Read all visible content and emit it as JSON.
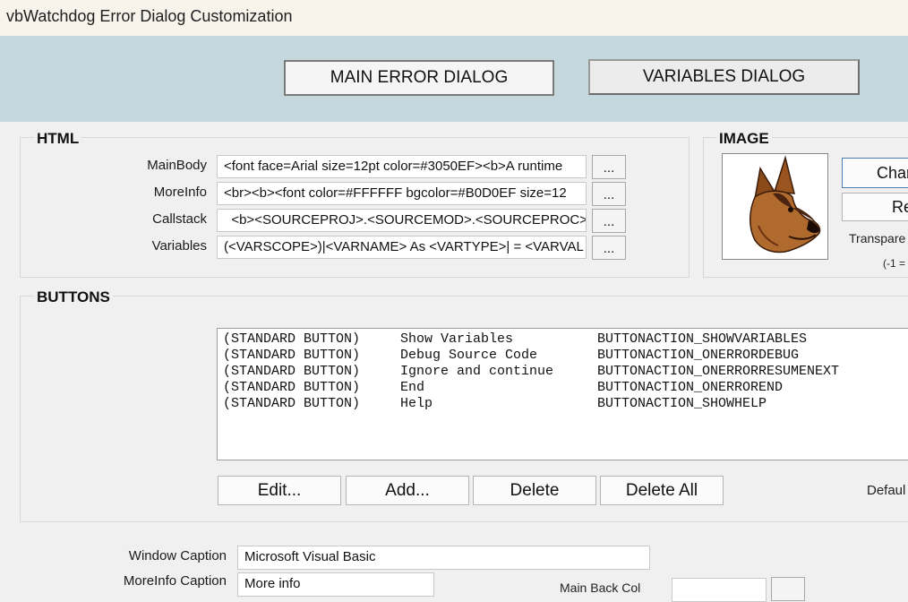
{
  "window": {
    "title": "vbWatchdog Error Dialog Customization"
  },
  "tabs": [
    {
      "label": "MAIN ERROR DIALOG"
    },
    {
      "label": "VARIABLES DIALOG"
    }
  ],
  "html_group": {
    "title": "HTML",
    "rows": [
      {
        "label": "MainBody",
        "value": "<font face=Arial size=12pt color=#3050EF><b>A runtime",
        "browse": "..."
      },
      {
        "label": "MoreInfo",
        "value": "<br><b><font color=#FFFFFF bgcolor=#B0D0EF size=12",
        "browse": "..."
      },
      {
        "label": "Callstack",
        "value": "  <b><SOURCEPROJ>.<SOURCEMOD>.<SOURCEPROC>",
        "browse": "..."
      },
      {
        "label": "Variables",
        "value": "(<VARSCOPE>)|<VARNAME> As <VARTYPE>| = <VARVAL",
        "browse": "..."
      }
    ]
  },
  "image_group": {
    "title": "IMAGE",
    "change_label": "Chan",
    "reset_label": "Re",
    "transparent_label": "Transpare",
    "transparent_hint": "(-1 ="
  },
  "buttons_group": {
    "title": "BUTTONS",
    "list": [
      {
        "type": "(STANDARD BUTTON)",
        "caption": "Show Variables",
        "action": "BUTTONACTION_SHOWVARIABLES"
      },
      {
        "type": "(STANDARD BUTTON)",
        "caption": "Debug Source Code",
        "action": "BUTTONACTION_ONERRORDEBUG"
      },
      {
        "type": "(STANDARD BUTTON)",
        "caption": "Ignore and continue",
        "action": "BUTTONACTION_ONERRORRESUMENEXT"
      },
      {
        "type": "(STANDARD BUTTON)",
        "caption": "End",
        "action": "BUTTONACTION_ONERROREND"
      },
      {
        "type": "(STANDARD BUTTON)",
        "caption": "Help",
        "action": "BUTTONACTION_SHOWHELP"
      }
    ],
    "edit_label": "Edit...",
    "add_label": "Add...",
    "delete_label": "Delete",
    "delete_all_label": "Delete All",
    "default_label": "Defaul"
  },
  "captions": {
    "window_caption_label": "Window Caption",
    "window_caption_value": "Microsoft Visual Basic",
    "moreinfo_caption_label": "MoreInfo Caption",
    "moreinfo_caption_value": "More info",
    "main_back_color_label": "Main Back Col"
  }
}
